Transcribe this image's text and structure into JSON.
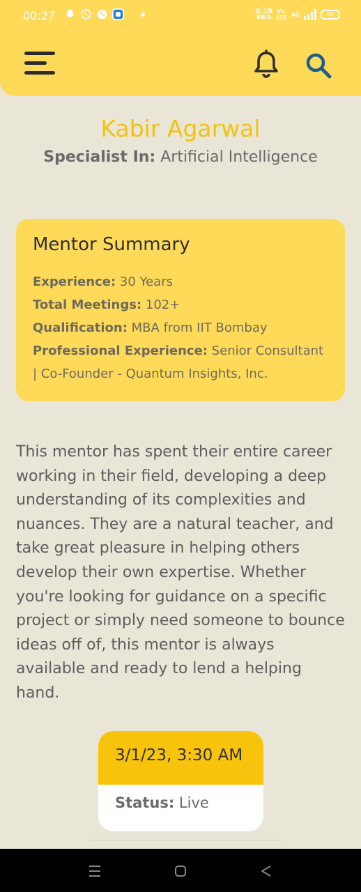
{
  "status_bar": {
    "time": "00:27",
    "net_speed_value": "0.19",
    "net_speed_unit": "KB/S",
    "volte_top": "Vo",
    "volte_bottom": "LTE",
    "network_type": "4G",
    "battery": "88",
    "notification_icons": [
      "snapchat-icon",
      "whatsapp-icon",
      "phone-icon",
      "app-icon"
    ]
  },
  "app_bar": {
    "menu_icon": "hamburger-menu-icon",
    "notification_icon": "bell-icon",
    "search_icon": "search-icon"
  },
  "mentor": {
    "name": "Kabir Agarwal",
    "specialist_label": "Specialist In:",
    "specialist_value": " Artificial Intelligence"
  },
  "summary": {
    "title": "Mentor Summary",
    "experience_label": "Experience:",
    "experience_value": " 30 Years",
    "meetings_label": "Total Meetings:",
    "meetings_value": " 102+",
    "qualification_label": "Qualification:",
    "qualification_value": " MBA from IIT Bombay",
    "professional_label": "Professional Experience:",
    "professional_value": " Senior Consultant | Co-Founder - Quantum Insights, Inc."
  },
  "description": "This mentor has spent their entire career working in their field, developing a deep understanding of its complexities and nuances. They are a natural teacher, and take great pleasure in helping others develop their own expertise. Whether you're looking for guidance on a specific project or simply need someone to bounce ideas off of, this mentor is always available and ready to lend a helping hand.",
  "session": {
    "datetime": "3/1/23, 3:30 AM",
    "status_label": "Status:",
    "status_value": " Live"
  },
  "nav_bar": {
    "buttons": [
      "recent-apps-icon",
      "home-icon",
      "back-icon"
    ]
  },
  "colors": {
    "header_yellow": "#ffda58",
    "name_yellow": "#f3c20e",
    "session_yellow": "#f8c40b",
    "background": "#e9e6d8"
  }
}
